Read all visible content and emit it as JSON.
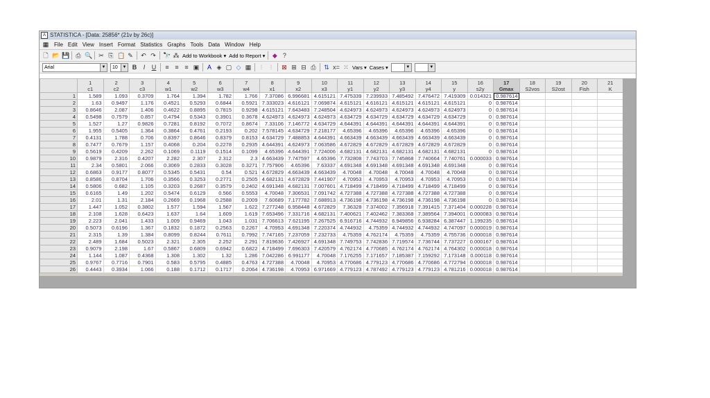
{
  "window": {
    "title": "STATISTICA - [Data: 25856* (21v by 26c)]"
  },
  "menu": [
    "File",
    "Edit",
    "View",
    "Insert",
    "Format",
    "Statistics",
    "Graphs",
    "Tools",
    "Data",
    "Window",
    "Help"
  ],
  "toolbar": {
    "add_workbook": "Add to Workbook ▾",
    "add_report": "Add to Report ▾"
  },
  "format_toolbar": {
    "font": "Arial",
    "size": "10",
    "vars": "Vars ▾",
    "cases": "Cases ▾"
  },
  "columns": [
    {
      "n": "1",
      "name": "c1"
    },
    {
      "n": "2",
      "name": "c2"
    },
    {
      "n": "3",
      "name": "c3"
    },
    {
      "n": "4",
      "name": "w1"
    },
    {
      "n": "5",
      "name": "w2"
    },
    {
      "n": "6",
      "name": "w3"
    },
    {
      "n": "7",
      "name": "w4"
    },
    {
      "n": "8",
      "name": "x1"
    },
    {
      "n": "9",
      "name": "x2"
    },
    {
      "n": "10",
      "name": "x3"
    },
    {
      "n": "11",
      "name": "y1"
    },
    {
      "n": "12",
      "name": "y2"
    },
    {
      "n": "13",
      "name": "y3"
    },
    {
      "n": "14",
      "name": "y4"
    },
    {
      "n": "15",
      "name": "y"
    },
    {
      "n": "16",
      "name": "s2y"
    },
    {
      "n": "17",
      "name": "Gmax"
    },
    {
      "n": "18",
      "name": "S2vos"
    },
    {
      "n": "19",
      "name": "S2ost"
    },
    {
      "n": "20",
      "name": "Fish"
    },
    {
      "n": "21",
      "name": "K"
    }
  ],
  "data": {
    "c1": [
      "1.589",
      "1.63",
      "0.8646",
      "0.5498",
      "1.527",
      "1.955",
      "0.4131",
      "0.7477",
      "0.5619",
      "0.9879",
      "2.34",
      "0.6863",
      "0.8586",
      "0.5806",
      "0.6165",
      "2.01",
      "1.447",
      "2.108",
      "2.223",
      "0.5073",
      "2.315",
      "2.489",
      "0.9079",
      "1.144",
      "0.9767",
      "0.4443"
    ],
    "c2": [
      "1.093",
      "0.9497",
      "2.087",
      "0.7579",
      "1.27",
      "0.5405",
      "1.788",
      "0.7679",
      "0.4209",
      "2.316",
      "0.5801",
      "0.9177",
      "0.8704",
      "0.682",
      "1.49",
      "1.31",
      "1.052",
      "1.628",
      "2.041",
      "0.6196",
      "1.39",
      "1.684",
      "2.198",
      "1.087",
      "0.7716",
      "0.3934"
    ],
    "c3": [
      "0.3709",
      "1.176",
      "1.406",
      "0.857",
      "0.9826",
      "1.364",
      "0.706",
      "1.157",
      "2.262",
      "0.4207",
      "2.066",
      "0.8077",
      "1.706",
      "1.105",
      "1.202",
      "2.184",
      "0.3802",
      "0.6423",
      "1.433",
      "1.367",
      "1.384",
      "0.5023",
      "1.67",
      "0.4368",
      "0.7901",
      "1.066"
    ],
    "w1": [
      "1.764",
      "0.4521",
      "0.4622",
      "0.4794",
      "0.7281",
      "0.3864",
      "0.8397",
      "0.4068",
      "0.1069",
      "2.282",
      "0.3069",
      "0.5345",
      "0.3566",
      "0.3203",
      "0.5474",
      "0.2669",
      "1.577",
      "1.637",
      "1.009",
      "0.1832",
      "0.8099",
      "2.321",
      "0.5867",
      "1.308",
      "0.583",
      "0.188"
    ],
    "w2": [
      "1.394",
      "0.5293",
      "0.8895",
      "0.5343",
      "0.8192",
      "0.4761",
      "0.8646",
      "0.204",
      "0.1119",
      "2.307",
      "0.2833",
      "0.5431",
      "0.3253",
      "0.2687",
      "0.6129",
      "0.1968",
      "1.594",
      "1.64",
      "0.9469",
      "0.1872",
      "0.8244",
      "2.305",
      "0.6809",
      "1.302",
      "0.5795",
      "0.1712"
    ],
    "w3": [
      "1.782",
      "0.6844",
      "0.7815",
      "0.3901",
      "0.7072",
      "0.2193",
      "0.8379",
      "0.2278",
      "0.1514",
      "2.312",
      "0.3028",
      "0.54",
      "0.2771",
      "0.3579",
      "0.566",
      "0.2588",
      "1.567",
      "1.609",
      "1.043",
      "0.2563",
      "0.7611",
      "2.252",
      "0.6942",
      "1.32",
      "0.4885",
      "0.1717"
    ],
    "w4": [
      "1.766",
      "0.5921",
      "0.9298",
      "0.3678",
      "0.8674",
      "0.202",
      "0.8153",
      "0.2935",
      "0.1099",
      "2.3",
      "0.3271",
      "0.521",
      "0.2505",
      "0.2402",
      "0.5553",
      "0.2009",
      "1.622",
      "1.619",
      "1.031",
      "0.2267",
      "0.7992",
      "2.291",
      "0.6822",
      "1.286",
      "0.4763",
      "0.2064"
    ],
    "x1": [
      "7.37086",
      "7.333023",
      "4.615121",
      "4.624973",
      "7.33106",
      "7.578145",
      "4.634729",
      "4.644391",
      "4.65396",
      "4.663439",
      "7.757906",
      "4.672829",
      "4.682131",
      "4.691348",
      "4.70048",
      "7.60689",
      "7.277248",
      "7.653496",
      "7.706613",
      "4.70953",
      "7.747165",
      "7.819636",
      "4.718499",
      "7.042286",
      "4.727388",
      "4.736198"
    ],
    "x2": [
      "6.996681",
      "4.616121",
      "7.643483",
      "4.624973",
      "7.146772",
      "4.634729",
      "7.488853",
      "4.624973",
      "4.644391",
      "7.747597",
      "4.65396",
      "4.663439",
      "4.672829",
      "4.682131",
      "7.306531",
      "7.177782",
      "6.958448",
      "7.331716",
      "7.621195",
      "4.691348",
      "7.237059",
      "7.426927",
      "7.696303",
      "6.991177",
      "4.70048",
      "4.70953"
    ],
    "x3": [
      "4.615121",
      "7.069874",
      "7.248504",
      "4.624973",
      "4.634729",
      "7.218177",
      "4.644391",
      "7.063586",
      "7.724006",
      "4.65396",
      "7.63337",
      "4.663439",
      "7.441907",
      "7.007601",
      "7.091742",
      "7.688913",
      "4.672829",
      "4.682131",
      "7.267525",
      "7.220374",
      "7.232733",
      "4.691348",
      "7.420579",
      "4.70048",
      "4.70953",
      "6.971669"
    ],
    "y1": [
      "7.475339",
      "4.615121",
      "4.624973",
      "4.634729",
      "4.644391",
      "4.65396",
      "4.663439",
      "4.672829",
      "4.682131",
      "7.732808",
      "4.691348",
      "4.70048",
      "4.70953",
      "4.718499",
      "4.727388",
      "4.736198",
      "7.36328",
      "7.400621",
      "6.916716",
      "4.744932",
      "4.75359",
      "7.749753",
      "4.762174",
      "7.176255",
      "4.770686",
      "4.779123"
    ],
    "y2": [
      "7.239933",
      "4.616121",
      "4.624973",
      "4.634729",
      "4.644391",
      "4.65396",
      "4.663439",
      "4.672829",
      "4.682131",
      "7.743703",
      "4.691348",
      "4.70048",
      "4.70953",
      "4.718499",
      "4.727388",
      "4.736198",
      "7.374002",
      "7.402462",
      "4.744932",
      "4.75359",
      "4.762174",
      "7.742836",
      "4.770685",
      "7.171657",
      "4.779123",
      "4.787492"
    ],
    "y3": [
      "7.485492",
      "4.615121",
      "4.624973",
      "4.634729",
      "4.644391",
      "4.65396",
      "4.663439",
      "4.672829",
      "4.682131",
      "7.745868",
      "4.691348",
      "4.70048",
      "4.70953",
      "4.718499",
      "4.727388",
      "4.736198",
      "7.356918",
      "7.383368",
      "6.949856",
      "4.744932",
      "4.75359",
      "7.719574",
      "4.762174",
      "7.185387",
      "4.770686",
      "4.779123"
    ],
    "y4": [
      "7.476472",
      "4.615121",
      "4.624973",
      "4.634729",
      "4.644391",
      "4.65396",
      "4.663439",
      "4.672829",
      "4.682131",
      "7.740664",
      "4.691348",
      "4.70048",
      "4.70953",
      "4.718499",
      "4.727388",
      "4.736198",
      "7.391415",
      "7.389564",
      "6.938284",
      "4.744932",
      "4.75359",
      "7.736744",
      "4.762174",
      "7.159292",
      "4.770686",
      "4.779123"
    ],
    "y": [
      "7.419309",
      "4.615121",
      "4.624973",
      "4.634729",
      "4.644391",
      "4.65396",
      "4.663439",
      "4.672829",
      "4.682131",
      "7.740761",
      "4.691348",
      "4.70048",
      "4.70953",
      "4.718499",
      "4.727388",
      "4.736198",
      "7.371404",
      "7.394001",
      "6.387447",
      "4.747097",
      "4.755736",
      "7.737227",
      "4.764302",
      "7.173148",
      "4.772794",
      "4.781216"
    ],
    "s2y": [
      "0.014321",
      "0",
      "0",
      "0",
      "0",
      "0",
      "0",
      "0",
      "0",
      "0.000033",
      "0",
      "0",
      "0",
      "0",
      "0",
      "0",
      "0.000228",
      "0.000083",
      "1.199235",
      "0.000019",
      "0.000018",
      "0.000167",
      "0.000018",
      "0.000118",
      "0.000018",
      "0.000018"
    ],
    "Gmax": [
      "0.987614",
      "0.987614",
      "0.987614",
      "0.987614",
      "0.987614",
      "0.987614",
      "0.987614",
      "0.987614",
      "0.987614",
      "0.987614",
      "0.987614",
      "0.987614",
      "0.987614",
      "0.987614",
      "0.987614",
      "0.987614",
      "0.987614",
      "0.987614",
      "0.987614",
      "0.987614",
      "0.987614",
      "0.987614",
      "0.987614",
      "0.987614",
      "0.987614",
      "0.987614"
    ]
  }
}
